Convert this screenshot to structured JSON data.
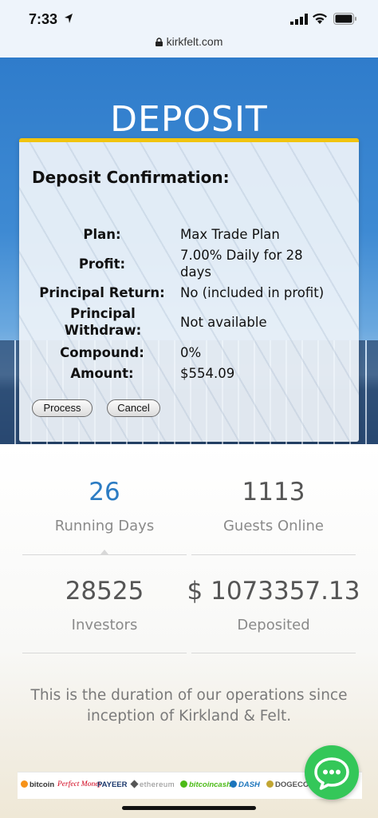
{
  "status_bar": {
    "time": "7:33"
  },
  "browser": {
    "url": "kirkfelt.com"
  },
  "hero": {
    "title": "DEPOSIT"
  },
  "confirmation": {
    "title": "Deposit Confirmation:",
    "rows": [
      {
        "label": "Plan:",
        "value": "Max Trade Plan"
      },
      {
        "label": "Profit:",
        "value": "7.00% Daily for 28 days"
      },
      {
        "label": "Principal Return:",
        "value": "No (included in profit)"
      },
      {
        "label": "Principal Withdraw:",
        "value": "Not available"
      },
      {
        "label": "Compound:",
        "value": "0%"
      },
      {
        "label": "Amount:",
        "value": "$554.09"
      }
    ],
    "process_label": "Process",
    "cancel_label": "Cancel"
  },
  "stats": [
    {
      "number": "26",
      "label": "Running Days"
    },
    {
      "number": "1113",
      "label": "Guests Online"
    },
    {
      "number": "28525",
      "label": "Investors"
    },
    {
      "number": "$ 1073357.13",
      "label": "Deposited"
    }
  ],
  "description": "This is the duration of our operations since inception of Kirkland & Felt.",
  "payments": [
    {
      "name": "bitcoin",
      "color": "#f7931a"
    },
    {
      "name": "Perfect Money",
      "color": "#d0021b"
    },
    {
      "name": "PAYEER",
      "color": "#1d3a6e"
    },
    {
      "name": "ethereum",
      "color": "#8a8a8a"
    },
    {
      "name": "bitcoincash",
      "color": "#4cbb17"
    },
    {
      "name": "DASH",
      "color": "#1c75bc"
    },
    {
      "name": "DOGECOIN",
      "color": "#555555"
    }
  ],
  "colors": {
    "accent": "#2c7cc3",
    "card_border": "#f1c40f",
    "chat": "#34c759"
  }
}
